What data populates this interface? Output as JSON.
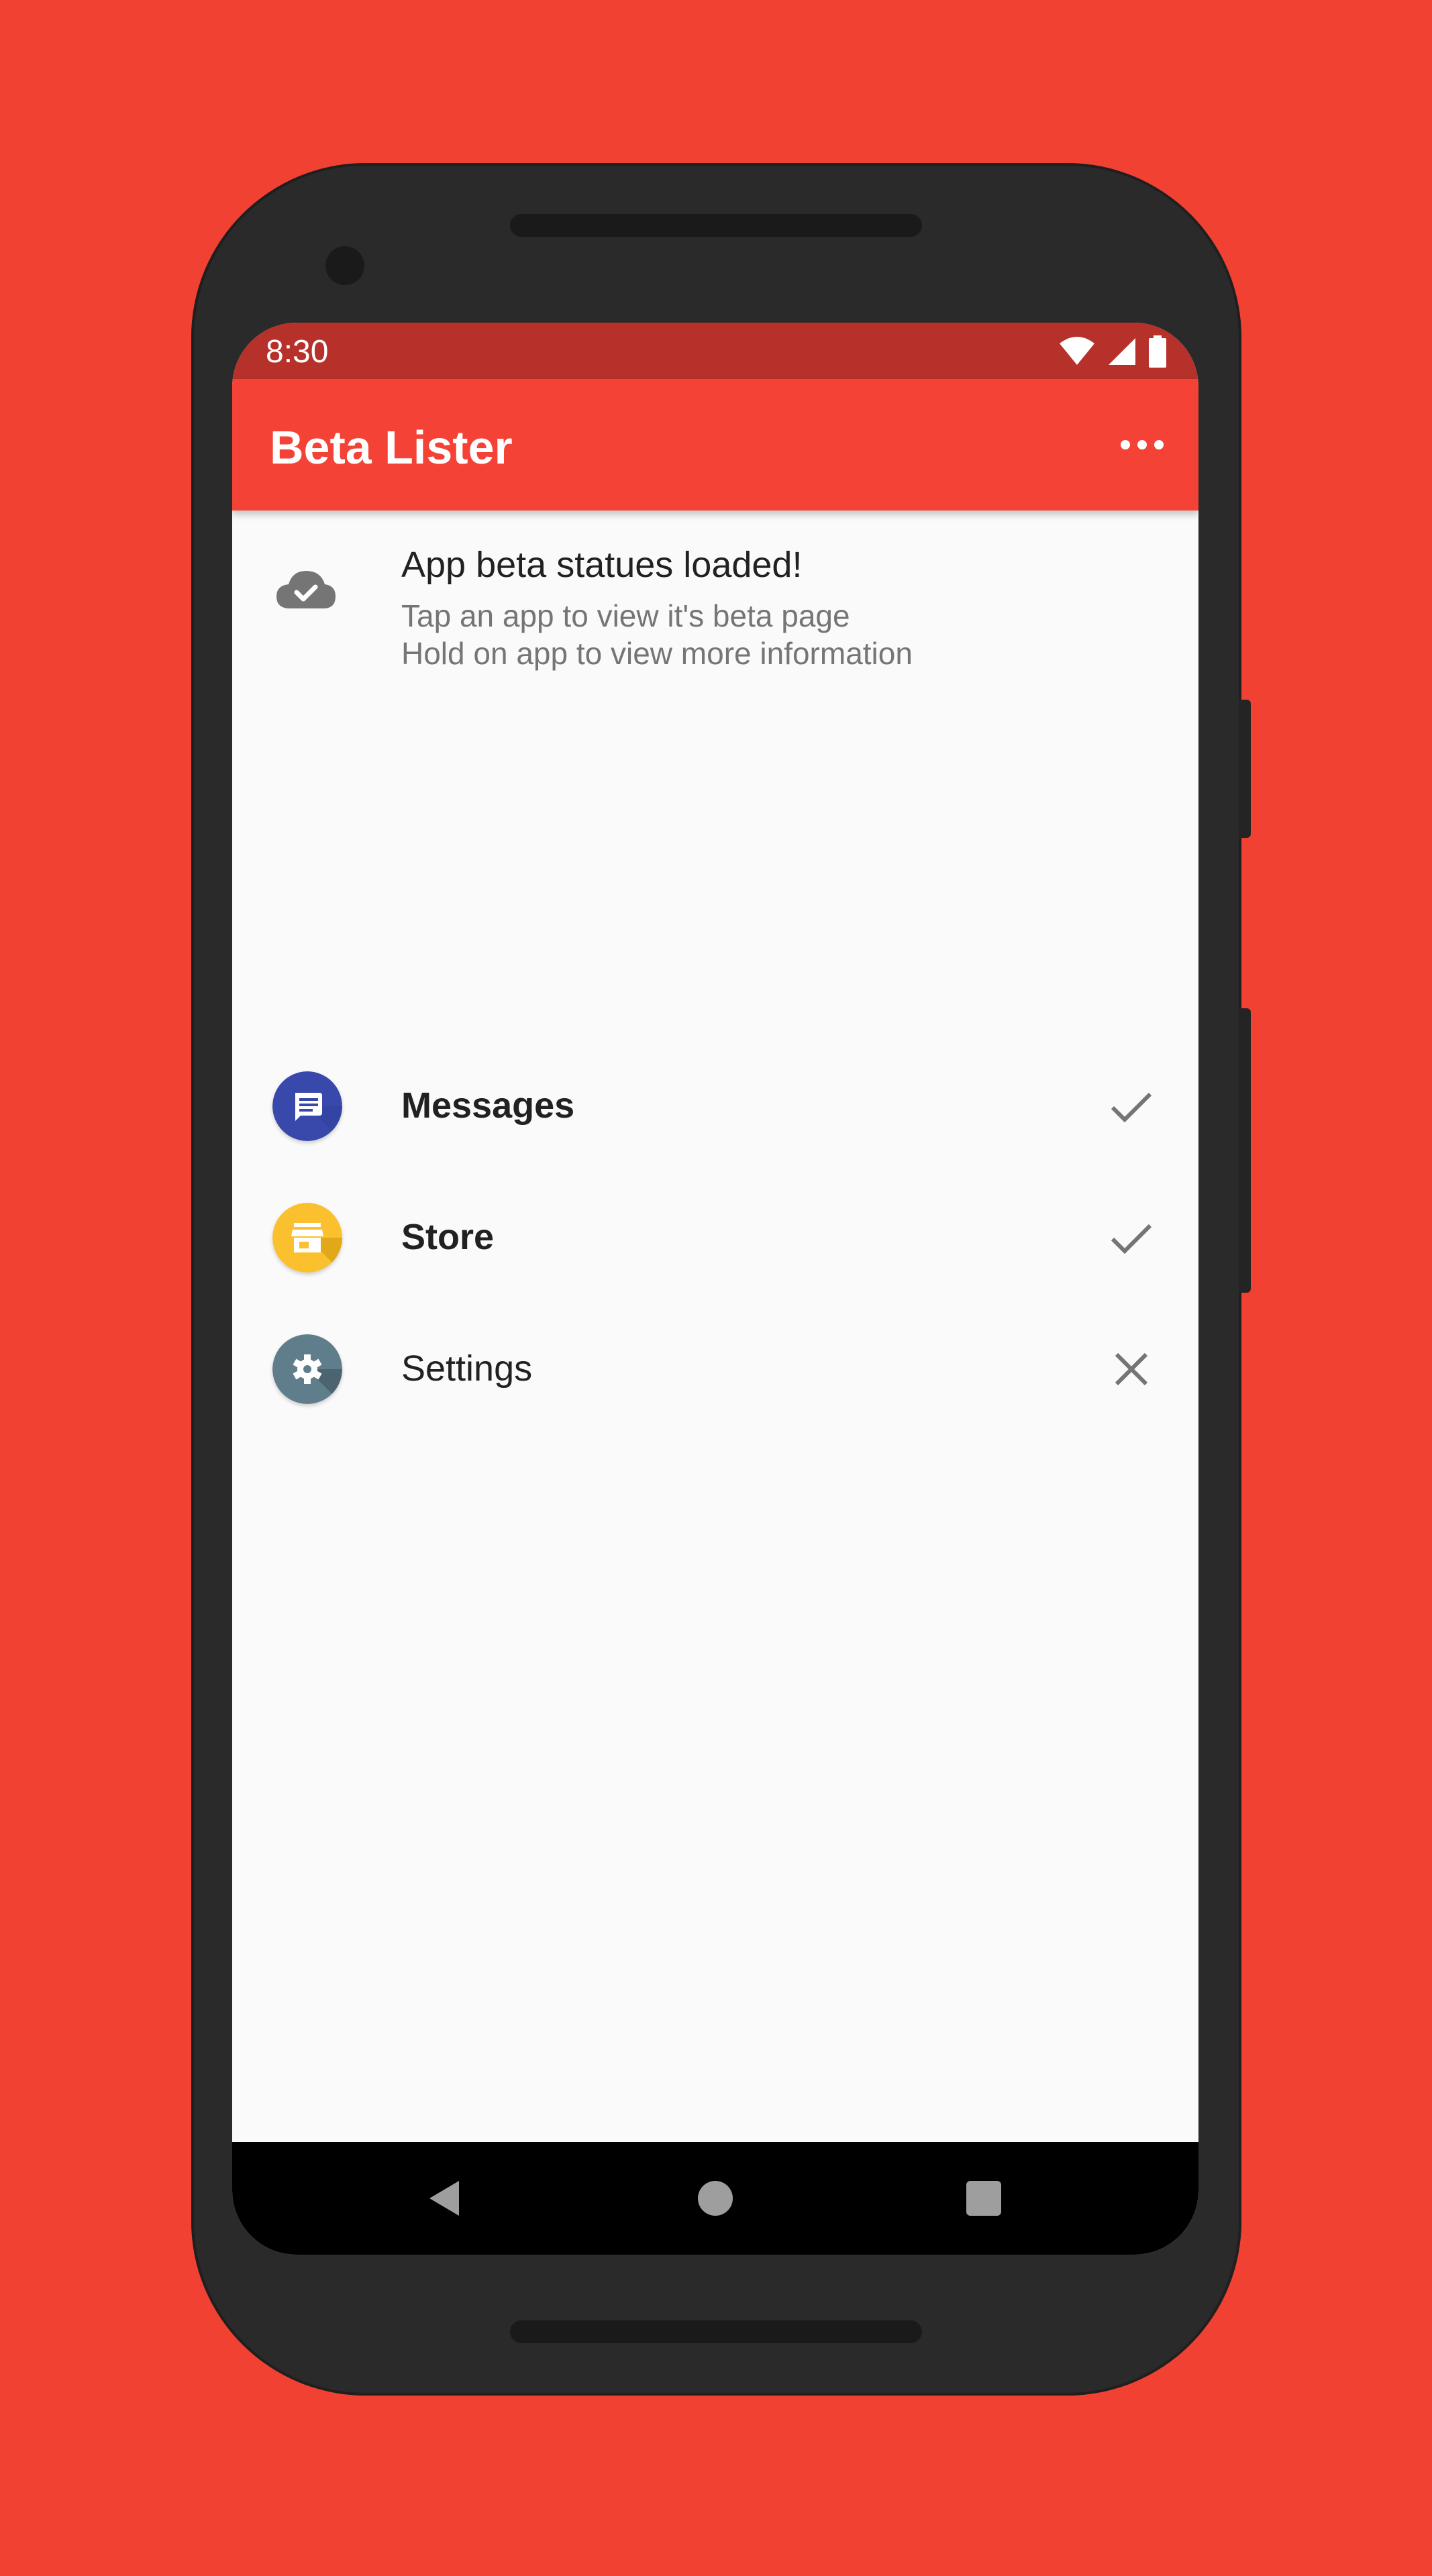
{
  "status_bar": {
    "time": "8:30",
    "icons": [
      "wifi-icon",
      "cell-signal-icon",
      "battery-icon"
    ]
  },
  "app_bar": {
    "title": "Beta Lister",
    "overflow_icon": "more-horiz-icon"
  },
  "info": {
    "icon": "cloud-done-icon",
    "title": "App beta statues loaded!",
    "line1": "Tap an app to view it's beta page",
    "line2": "Hold on app to view more information"
  },
  "apps": [
    {
      "name": "Messages",
      "icon": "messages-icon",
      "color": "#3949ab",
      "status": "check",
      "bold": true
    },
    {
      "name": "Store",
      "icon": "store-icon",
      "color": "#fbc02d",
      "status": "check",
      "bold": true
    },
    {
      "name": "Settings",
      "icon": "settings-icon",
      "color": "#607d8b",
      "status": "close",
      "bold": false
    }
  ],
  "colors": {
    "background": "#f04132",
    "app_bar": "#f44336",
    "status_bar": "#b7312b",
    "status_icon": "#757575"
  },
  "nav": {
    "icons": [
      "back-icon",
      "home-icon",
      "recents-icon"
    ]
  }
}
